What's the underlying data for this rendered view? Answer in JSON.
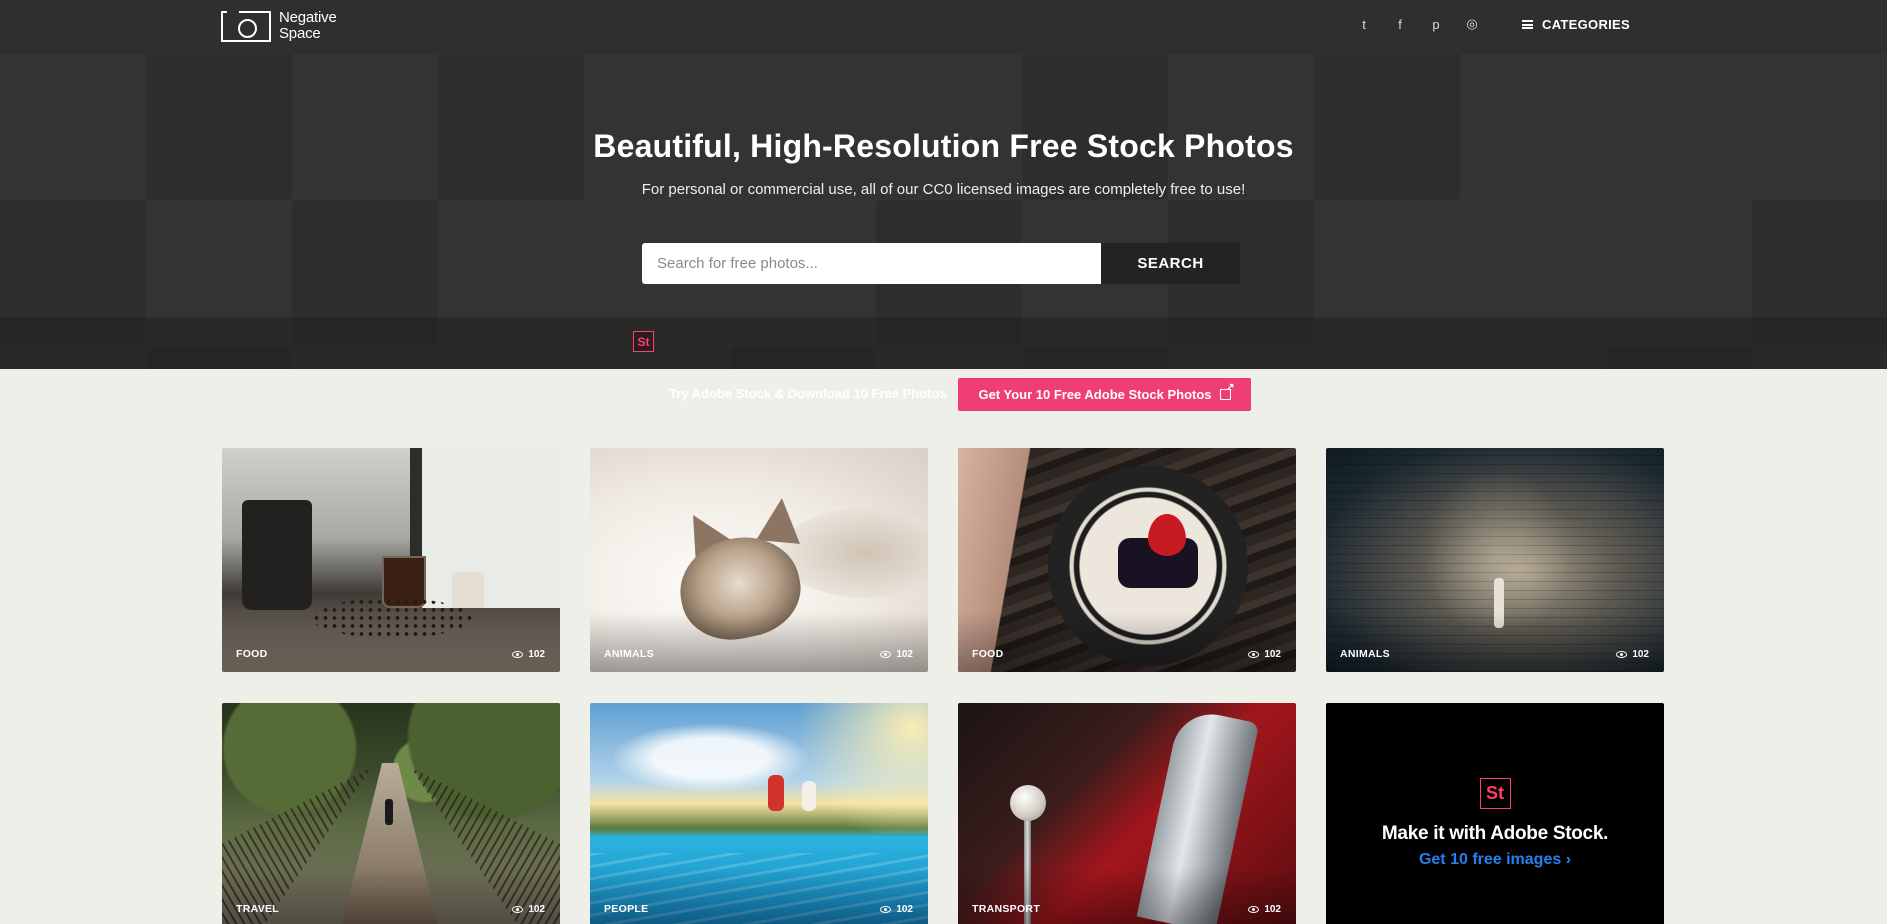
{
  "header": {
    "logo_line1": "Negative",
    "logo_line2": "Space",
    "social": [
      {
        "icon": "twitter-icon",
        "glyph": "t"
      },
      {
        "icon": "facebook-icon",
        "glyph": "f"
      },
      {
        "icon": "pinterest-icon",
        "glyph": "p"
      },
      {
        "icon": "instagram-icon",
        "glyph": "◎"
      }
    ],
    "categories_label": "CATEGORIES"
  },
  "hero": {
    "title": "Beautiful, High-Resolution Free Stock Photos",
    "subtitle": "For personal or commercial use, all of our CC0 licensed images are completely free to use!",
    "search_placeholder": "Search for free photos...",
    "search_value": "",
    "search_button": "SEARCH"
  },
  "promo": {
    "badge": "St",
    "text": "Try Adobe Stock & Download 10 Free Photos",
    "button": "Get Your 10 Free Adobe Stock Photos"
  },
  "photos": [
    {
      "category": "FOOD",
      "views": "102"
    },
    {
      "category": "ANIMALS",
      "views": "102"
    },
    {
      "category": "FOOD",
      "views": "102"
    },
    {
      "category": "ANIMALS",
      "views": "102"
    },
    {
      "category": "TRAVEL",
      "views": "102"
    },
    {
      "category": "PEOPLE",
      "views": "102"
    },
    {
      "category": "TRANSPORT",
      "views": "102"
    }
  ],
  "adobe_card": {
    "badge": "St",
    "headline": "Make it with Adobe Stock.",
    "link": "Get 10 free images ›"
  },
  "colors": {
    "header_bg": "#2f2f2f",
    "accent_pink": "#ef3e73",
    "adobe_blue": "#2680eb",
    "page_bg": "#efefea"
  }
}
